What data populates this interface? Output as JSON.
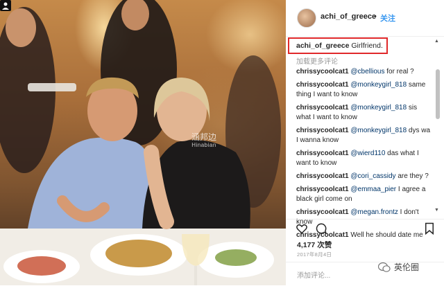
{
  "photo": {
    "watermark_main": "涵邦边",
    "watermark_sub": "Hinabian"
  },
  "header": {
    "username": "achi_of_greece",
    "separator": "•",
    "follow_label": "关注"
  },
  "caption": {
    "username": "achi_of_greece",
    "text": "Girlfriend."
  },
  "load_more": "加载更多评论",
  "comments": [
    {
      "user": "chrissycoolcat1",
      "mention": "@cbellious",
      "text": " for real ?"
    },
    {
      "user": "chrissycoolcat1",
      "mention": "@monkeygirl_818",
      "text": " same thing I want to know"
    },
    {
      "user": "chrissycoolcat1",
      "mention": "@monkeygirl_818",
      "text": " sis what I want to know"
    },
    {
      "user": "chrissycoolcat1",
      "mention": "@monkeygirl_818",
      "text": " dys wa I wanna know"
    },
    {
      "user": "chrissycoolcat1",
      "mention": "@wierd110",
      "text": " das what I want to know"
    },
    {
      "user": "chrissycoolcat1",
      "mention": "@cori_cassidy",
      "text": " are they ?"
    },
    {
      "user": "chrissycoolcat1",
      "mention": "@emmaa_pier",
      "text": " I agree a black girl come on"
    },
    {
      "user": "chrissycoolcat1",
      "mention": "@megan.frontz",
      "text": " I don't know"
    },
    {
      "user": "chrissycoolcat1",
      "mention": "",
      "text": " Well he should date me"
    }
  ],
  "likes": "4,177 次赞",
  "date": "2017年8月4日",
  "add_comment_placeholder": "添加评论...",
  "brand": "英伦圈",
  "colors": {
    "accent": "#3897f0",
    "highlight": "#e0282a",
    "mention": "#003569"
  },
  "icons": [
    "heart-icon",
    "comment-icon",
    "bookmark-icon",
    "multi-photo-icon",
    "wechat-icon",
    "avatar"
  ]
}
